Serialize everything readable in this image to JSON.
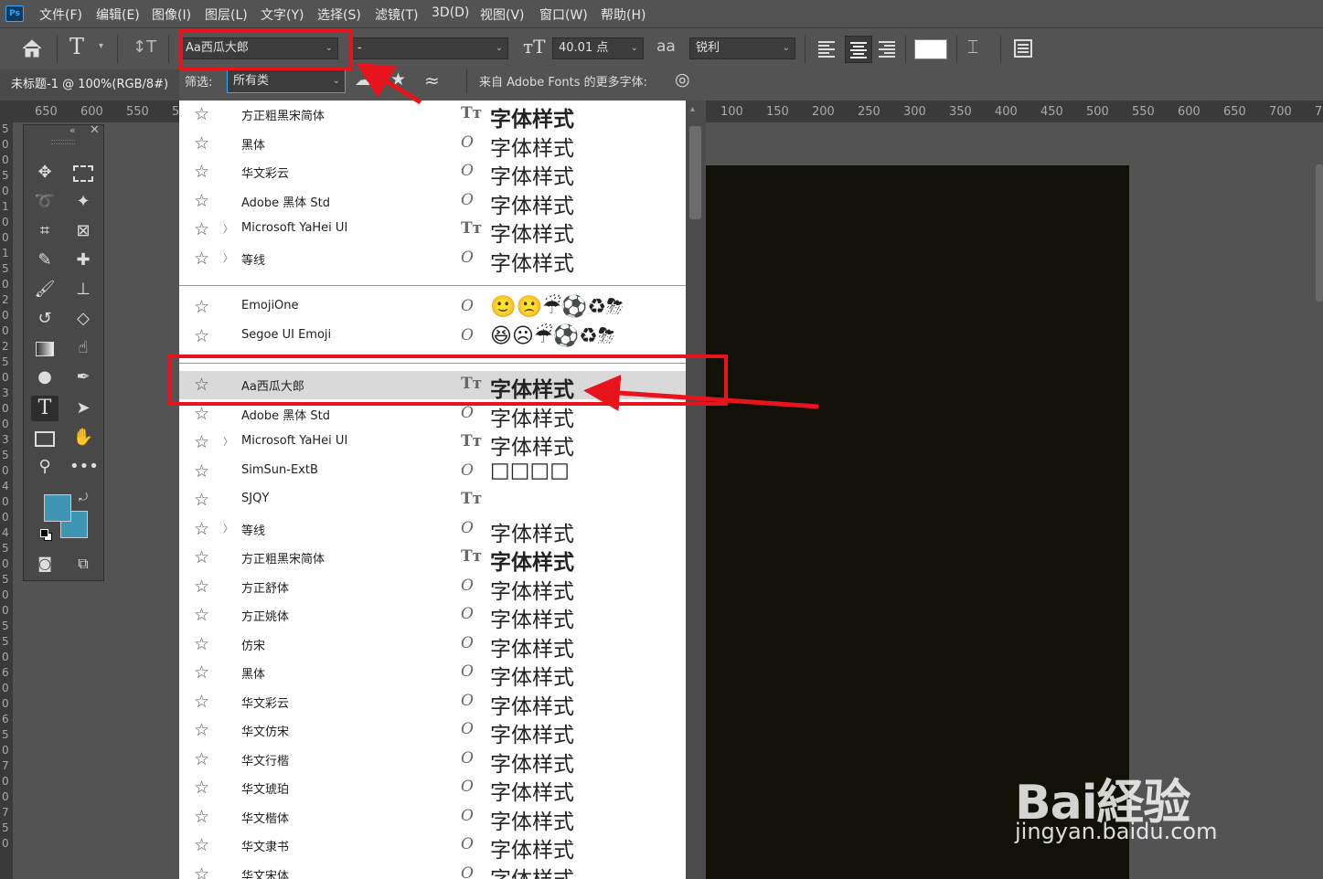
{
  "app": {
    "logo": "Ps"
  },
  "menu": [
    "文件(F)",
    "编辑(E)",
    "图像(I)",
    "图层(L)",
    "文字(Y)",
    "选择(S)",
    "滤镜(T)",
    "3D(D)",
    "视图(V)",
    "窗口(W)",
    "帮助(H)"
  ],
  "options": {
    "font_family": "Aa西瓜大郎",
    "font_style": "-",
    "font_size": "40.01 点",
    "aa_icon_label": "aa",
    "antialias": "锐利",
    "color_swatch": "#ffffff"
  },
  "filter": {
    "label": "筛选:",
    "value": "所有类",
    "adobe_fonts_text": "来自 Adobe Fonts 的更多字体:"
  },
  "document_tab": "未标题-1 @ 100%(RGB/8#)",
  "ruler_top_left": [
    "650",
    "600",
    "550",
    "5"
  ],
  "ruler_top_right": [
    "100",
    "150",
    "200",
    "250",
    "300",
    "350",
    "400",
    "450",
    "500",
    "550",
    "600",
    "650",
    "700",
    "7"
  ],
  "ruler_left": [
    "5",
    "0",
    "0",
    "5",
    "0",
    "1",
    "0",
    "0",
    "1",
    "5",
    "0",
    "2",
    "0",
    "0",
    "2",
    "5",
    "0",
    "3",
    "0",
    "0",
    "3",
    "5",
    "0",
    "4",
    "0",
    "0",
    "4",
    "5",
    "0",
    "5",
    "0",
    "0",
    "5",
    "5",
    "0",
    "6",
    "0",
    "0",
    "6",
    "5",
    "0",
    "7",
    "0",
    "0",
    "7",
    "5",
    "0"
  ],
  "colors": {
    "foreground": "#3f96b4",
    "background": "#3f96b4",
    "canvas": "#121107",
    "annotation": "#e8131b"
  },
  "font_groups": {
    "recent": [
      {
        "name": "方正粗黑宋简体",
        "type": "TT",
        "sample": "字体样式",
        "expand": false
      },
      {
        "name": "黑体",
        "type": "O",
        "sample": "字体样式",
        "expand": false
      },
      {
        "name": "华文彩云",
        "type": "O",
        "sample": "字体样式",
        "expand": false
      },
      {
        "name": "Adobe 黑体 Std",
        "type": "O",
        "sample": "字体样式",
        "expand": false
      },
      {
        "name": "Microsoft YaHei UI",
        "type": "TT",
        "sample": "字体样式",
        "expand": true
      },
      {
        "name": "等线",
        "type": "O",
        "sample": "字体样式",
        "expand": true
      }
    ],
    "emoji": [
      {
        "name": "EmojiOne",
        "type": "O",
        "sample": "🙂🙁☔⚽♻⛈",
        "expand": false
      },
      {
        "name": "Segoe UI Emoji",
        "type": "O",
        "sample": "😆☹☔⚽♻⛈",
        "expand": false
      }
    ],
    "all": [
      {
        "name": "Aa西瓜大郎",
        "type": "TT",
        "sample": "字体样式",
        "expand": false
      },
      {
        "name": "Adobe 黑体 Std",
        "type": "O",
        "sample": "字体样式",
        "expand": false
      },
      {
        "name": "Microsoft YaHei UI",
        "type": "TT",
        "sample": "字体样式",
        "expand": true
      },
      {
        "name": "SimSun-ExtB",
        "type": "O",
        "sample": "□□□□",
        "expand": false
      },
      {
        "name": "SJQY",
        "type": "TT",
        "sample": "",
        "expand": false
      },
      {
        "name": "等线",
        "type": "O",
        "sample": "字体样式",
        "expand": true
      },
      {
        "name": "方正粗黑宋简体",
        "type": "TT",
        "sample": "字体样式",
        "expand": false
      },
      {
        "name": "方正舒体",
        "type": "O",
        "sample": "字体样式",
        "expand": false
      },
      {
        "name": "方正姚体",
        "type": "O",
        "sample": "字体样式",
        "expand": false
      },
      {
        "name": "仿宋",
        "type": "O",
        "sample": "字体样式",
        "expand": false
      },
      {
        "name": "黑体",
        "type": "O",
        "sample": "字体样式",
        "expand": false
      },
      {
        "name": "华文彩云",
        "type": "O",
        "sample": "字体样式",
        "expand": false
      },
      {
        "name": "华文仿宋",
        "type": "O",
        "sample": "字体样式",
        "expand": false
      },
      {
        "name": "华文行楷",
        "type": "O",
        "sample": "字体样式",
        "expand": false
      },
      {
        "name": "华文琥珀",
        "type": "O",
        "sample": "字体样式",
        "expand": false
      },
      {
        "name": "华文楷体",
        "type": "O",
        "sample": "字体样式",
        "expand": false
      },
      {
        "name": "华文隶书",
        "type": "O",
        "sample": "字体样式",
        "expand": false
      },
      {
        "name": "华文宋体",
        "type": "O",
        "sample": "字体样式",
        "expand": false
      }
    ]
  },
  "watermark": {
    "logo": "Bai経验",
    "url": "jingyan.baidu.com"
  }
}
